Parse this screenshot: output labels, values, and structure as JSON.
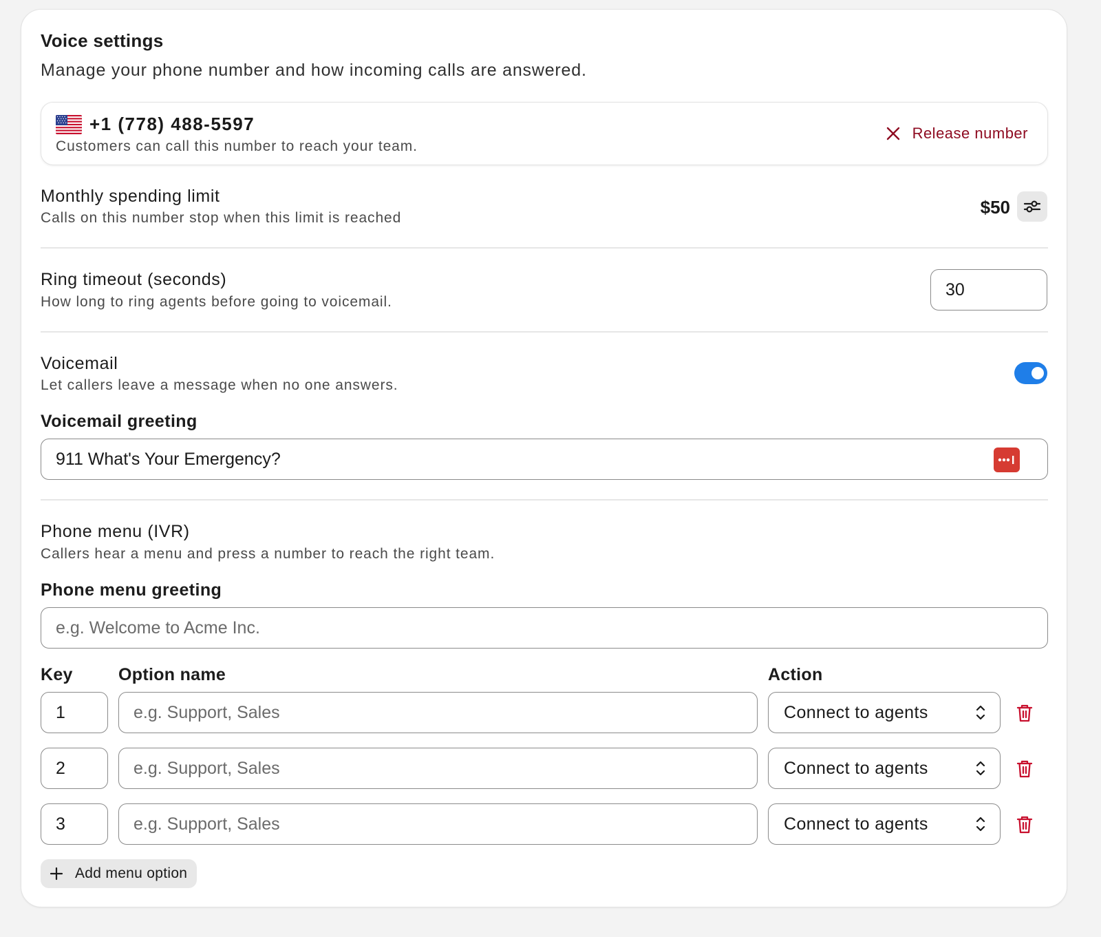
{
  "header": {
    "title": "Voice settings",
    "subtitle": "Manage your phone number and how incoming calls are answered."
  },
  "phone": {
    "number": "+1 (778) 488-5597",
    "description": "Customers can call this number to reach your team.",
    "release_label": "Release number",
    "flag": "us-flag-icon"
  },
  "spending": {
    "title": "Monthly spending limit",
    "description": "Calls on this number stop when this limit is reached",
    "value": "$50"
  },
  "ring_timeout": {
    "title": "Ring timeout (seconds)",
    "description": "How long to ring agents before going to voicemail.",
    "value": "30"
  },
  "voicemail": {
    "title": "Voicemail",
    "description": "Let callers leave a message when no one answers.",
    "enabled": true,
    "greeting_label": "Voicemail greeting",
    "greeting_value": "911 What's Your Emergency?"
  },
  "ivr": {
    "title": "Phone menu (IVR)",
    "description": "Callers hear a menu and press a number to reach the right team.",
    "greeting_label": "Phone menu greeting",
    "greeting_placeholder": "e.g. Welcome to Acme Inc.",
    "columns": {
      "key": "Key",
      "option": "Option name",
      "action": "Action"
    },
    "rows": [
      {
        "key": "1",
        "option_placeholder": "e.g. Support, Sales",
        "action": "Connect to agents"
      },
      {
        "key": "2",
        "option_placeholder": "e.g. Support, Sales",
        "action": "Connect to agents"
      },
      {
        "key": "3",
        "option_placeholder": "e.g. Support, Sales",
        "action": "Connect to agents"
      }
    ],
    "add_label": "Add menu option"
  },
  "colors": {
    "danger": "#8e0b21",
    "toggle_on": "#1f7ee8",
    "trash": "#c8102e"
  }
}
